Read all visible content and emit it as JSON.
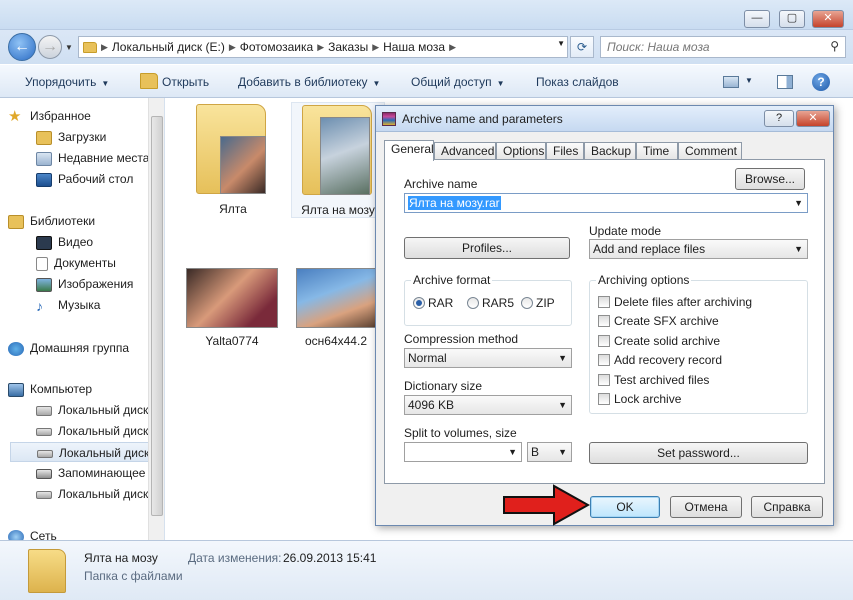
{
  "explorer": {
    "window_buttons": {
      "minimize": "—",
      "maximize": "▢",
      "close": "✕"
    },
    "address": {
      "crumbs": [
        "Локальный диск (E:)",
        "Фотомозаика",
        "Заказы",
        "Наша моза"
      ]
    },
    "search": {
      "placeholder": "Поиск: Наша моза"
    },
    "toolbar": {
      "organize": "Упорядочить",
      "open": "Открыть",
      "add_to_library": "Добавить в библиотеку",
      "share": "Общий доступ",
      "slideshow": "Показ слайдов"
    },
    "sidebar": {
      "favorites": "Избранное",
      "downloads": "Загрузки",
      "recent": "Недавние места",
      "desktop": "Рабочий стол",
      "libraries": "Библиотеки",
      "video": "Видео",
      "documents": "Документы",
      "pictures": "Изображения",
      "music": "Музыка",
      "homegroup": "Домашняя группа",
      "computer": "Компьютер",
      "disk1": "Локальный диск",
      "disk2": "Локальный диск",
      "disk3": "Локальный диск",
      "removable": "Запоминающее",
      "disk4": "Локальный диск",
      "network": "Сеть"
    },
    "files": [
      {
        "name": "Ялта"
      },
      {
        "name": "Ялта на мозу"
      },
      {
        "name": "Yalta0774"
      },
      {
        "name": "осн64х44.2"
      }
    ],
    "status": {
      "name": "Ялта на мозу",
      "date_label": "Дата изменения:",
      "date": "26.09.2013 15:41",
      "type": "Папка с файлами"
    }
  },
  "dialog": {
    "title": "Archive name and parameters",
    "help_button": "?",
    "close_button": "✕",
    "tabs": [
      "General",
      "Advanced",
      "Options",
      "Files",
      "Backup",
      "Time",
      "Comment"
    ],
    "archive_name_label": "Archive name",
    "browse_button": "Browse...",
    "archive_name_value": "Ялта на мозу.rar",
    "profiles_button": "Profiles...",
    "update_mode_label": "Update mode",
    "update_mode_value": "Add and replace files",
    "archive_format_label": "Archive format",
    "formats": [
      "RAR",
      "RAR5",
      "ZIP"
    ],
    "selected_format": "RAR",
    "archiving_options_label": "Archiving options",
    "options": [
      "Delete files after archiving",
      "Create SFX archive",
      "Create solid archive",
      "Add recovery record",
      "Test archived files",
      "Lock archive"
    ],
    "compression_label": "Compression method",
    "compression_value": "Normal",
    "dictionary_label": "Dictionary size",
    "dictionary_value": "4096 KB",
    "split_label": "Split to volumes, size",
    "split_value": "",
    "split_unit": "B",
    "set_password_button": "Set password...",
    "ok_button": "OK",
    "cancel_button": "Отмена",
    "help_button_footer": "Справка"
  },
  "colors": {
    "arrow": "#e0201c",
    "ok_border": "#3c7fb1"
  }
}
